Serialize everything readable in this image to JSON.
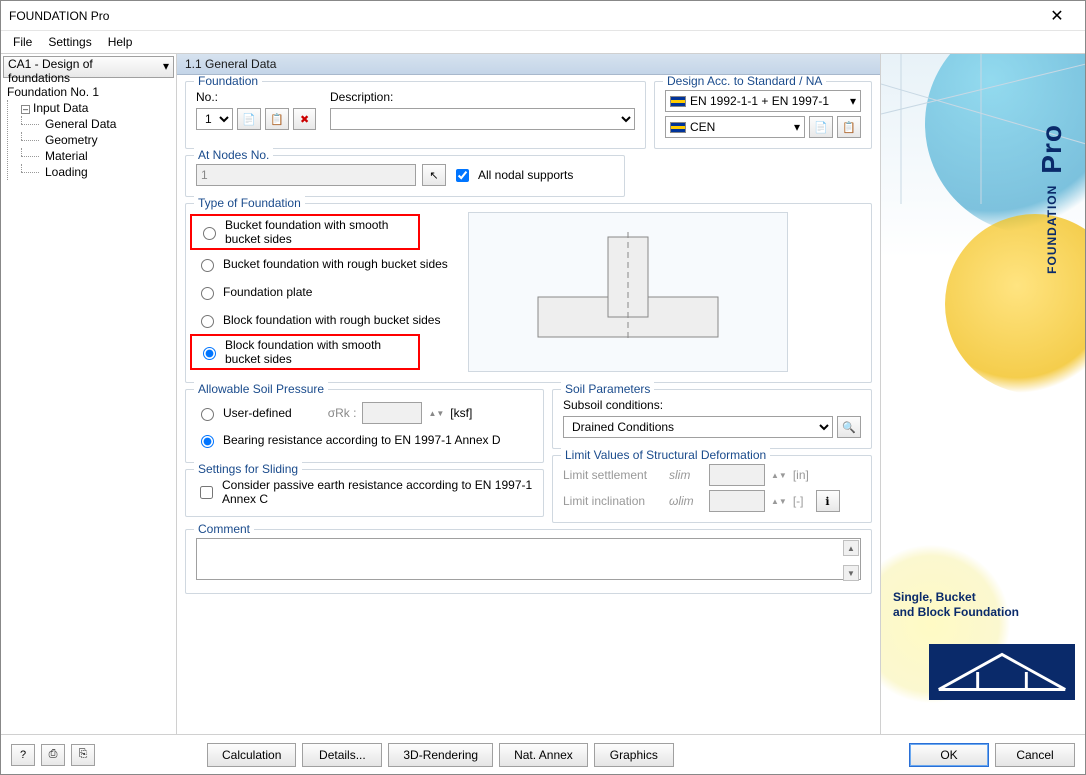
{
  "window": {
    "title": "FOUNDATION Pro"
  },
  "menu": {
    "file": "File",
    "settings": "Settings",
    "help": "Help"
  },
  "left": {
    "caseSelect": "CA1 - Design of foundations",
    "tree": {
      "root": "Foundation No. 1",
      "inputData": "Input Data",
      "items": [
        "General Data",
        "Geometry",
        "Material",
        "Loading"
      ]
    }
  },
  "header": "1.1 General Data",
  "foundation": {
    "title": "Foundation",
    "noLabel": "No.:",
    "noValue": "1",
    "descLabel": "Description:",
    "descValue": ""
  },
  "standard": {
    "title": "Design Acc. to Standard / NA",
    "line1": "EN 1992-1-1 + EN 1997-1",
    "line2": "CEN"
  },
  "atNodes": {
    "title": "At Nodes No.",
    "value": "1",
    "allNodal": "All nodal supports"
  },
  "typeFoundation": {
    "title": "Type of Foundation",
    "opts": [
      "Bucket foundation with smooth bucket sides",
      "Bucket foundation with rough bucket sides",
      "Foundation plate",
      "Block foundation with rough bucket sides",
      "Block foundation with smooth bucket sides"
    ]
  },
  "allowable": {
    "title": "Allowable Soil Pressure",
    "opt1": "User-defined",
    "sigmaLabel": "σRk :",
    "unit": "[ksf]",
    "opt2": "Bearing resistance according to EN 1997-1 Annex D"
  },
  "sliding": {
    "title": "Settings for Sliding",
    "check": "Consider passive earth resistance according to EN 1997-1 Annex C"
  },
  "soil": {
    "title": "Soil Parameters",
    "subsoilLabel": "Subsoil conditions:",
    "subsoilValue": "Drained Conditions"
  },
  "limits": {
    "title": "Limit Values of Structural Deformation",
    "settlement": "Limit settlement",
    "slim": "slim",
    "unitIn": "[in]",
    "inclination": "Limit inclination",
    "wlim": "ωlim",
    "unitDash": "[-]"
  },
  "comment": {
    "title": "Comment"
  },
  "brand": {
    "main": "FOUNDATION",
    "pro": "Pro",
    "sub1": "Single, Bucket",
    "sub2": "and Block Foundation"
  },
  "footer": {
    "calc": "Calculation",
    "details": "Details...",
    "render": "3D-Rendering",
    "annex": "Nat. Annex",
    "graphics": "Graphics",
    "ok": "OK",
    "cancel": "Cancel"
  }
}
